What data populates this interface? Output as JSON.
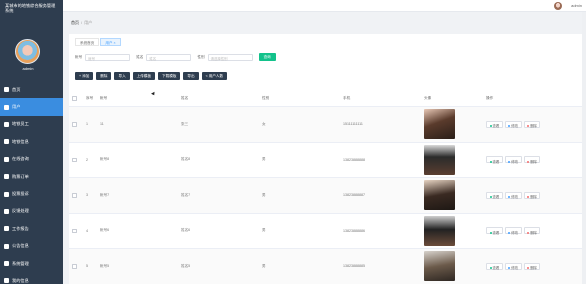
{
  "app": {
    "title": "某城市的地铁综合服务管理系统"
  },
  "sidebar": {
    "user": "admin",
    "items": [
      {
        "label": "首页",
        "icon": "home-icon",
        "active": false
      },
      {
        "label": "用户",
        "icon": "user-icon",
        "active": true
      },
      {
        "label": "地铁员工",
        "icon": "staff-icon",
        "active": false
      },
      {
        "label": "地铁信息",
        "icon": "metro-icon",
        "active": false
      },
      {
        "label": "在线咨询",
        "icon": "chat-icon",
        "active": false
      },
      {
        "label": "购票订单",
        "icon": "order-icon",
        "active": false
      },
      {
        "label": "投票投诉",
        "icon": "vote-icon",
        "active": false
      },
      {
        "label": "反馈处理",
        "icon": "feedback-icon",
        "active": false
      },
      {
        "label": "工作报告",
        "icon": "report-icon",
        "active": false
      },
      {
        "label": "公告信息",
        "icon": "notice-icon",
        "active": false
      },
      {
        "label": "系统管理",
        "icon": "system-icon",
        "active": false
      },
      {
        "label": "我的信息",
        "icon": "profile-icon",
        "active": false
      }
    ]
  },
  "topbar": {
    "user": "admin"
  },
  "breadcrumb": {
    "home": "首页",
    "sep": "/",
    "current": "用户"
  },
  "tabs": [
    {
      "label": "系统首页",
      "active": false
    },
    {
      "label": "用户 ×",
      "active": true
    }
  ],
  "search": {
    "fields": [
      {
        "label": "帐号",
        "placeholder": "帐号"
      },
      {
        "label": "姓名",
        "placeholder": "姓名"
      },
      {
        "label": "性别",
        "placeholder": "请选择性别"
      }
    ],
    "button": "查询"
  },
  "actions": [
    "+ 添加",
    "删除",
    "导入",
    "上传模板",
    "下载模板",
    "导出",
    "< 用户人数"
  ],
  "table": {
    "headers": [
      "",
      "序号",
      "帐号",
      "姓名",
      "性别",
      "手机",
      "头像",
      "操作"
    ],
    "rows": [
      {
        "idx": "1",
        "account": "11",
        "name": "张三",
        "sex": "女",
        "phone": "15111111111"
      },
      {
        "idx": "2",
        "account": "帐号8",
        "name": "姓名8",
        "sex": "男",
        "phone": "13823888888"
      },
      {
        "idx": "3",
        "account": "帐号7",
        "name": "姓名7",
        "sex": "男",
        "phone": "13823888887"
      },
      {
        "idx": "4",
        "account": "帐号6",
        "name": "姓名6",
        "sex": "男",
        "phone": "13823888886"
      },
      {
        "idx": "5",
        "account": "帐号5",
        "name": "姓名5",
        "sex": "男",
        "phone": "13823888885"
      }
    ],
    "ops": {
      "view": "查看",
      "edit": "修改",
      "delete": "删除"
    }
  },
  "colors": {
    "sidebar": "#2e3d4f",
    "active": "#3a8de0",
    "search_button": "#13c28b"
  }
}
